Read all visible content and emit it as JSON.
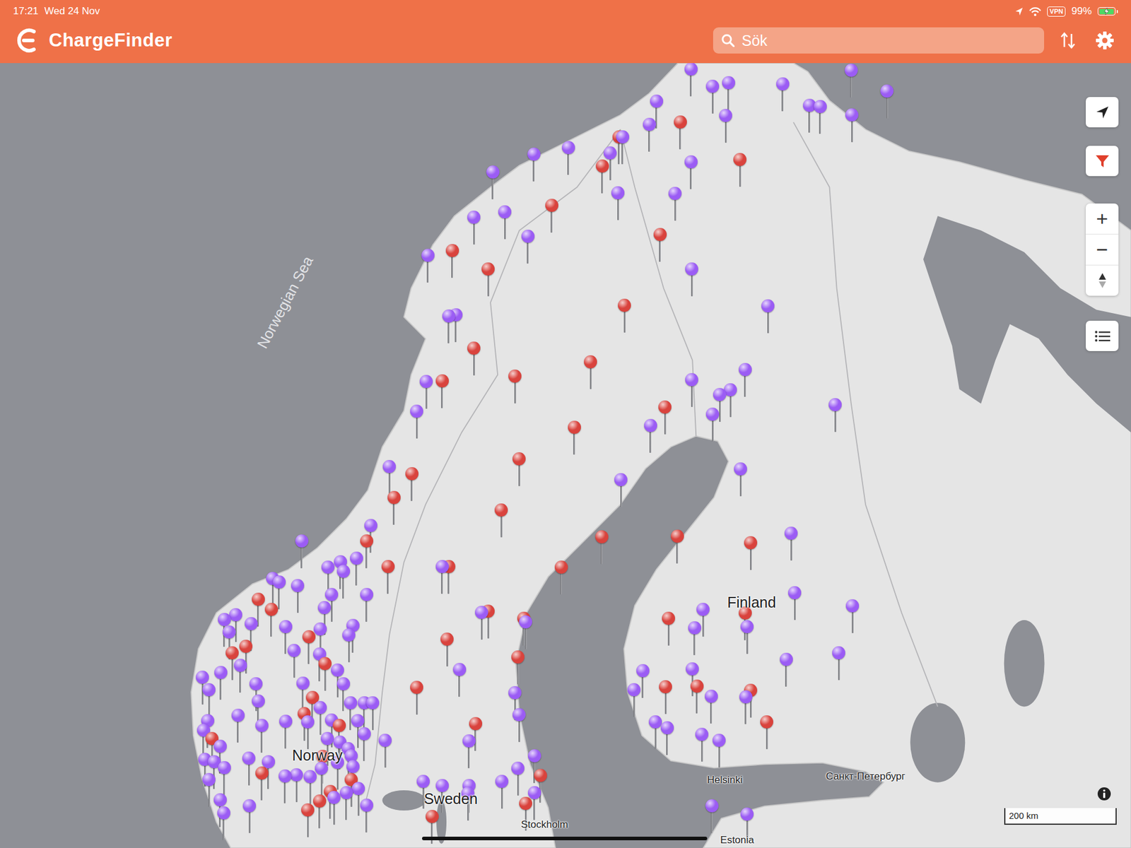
{
  "status_bar": {
    "time": "17:21",
    "date": "Wed 24 Nov",
    "vpn": "VPN",
    "battery": "99%",
    "battery_level": 0.99,
    "charging": true
  },
  "app_bar": {
    "title": "ChargeFinder"
  },
  "search": {
    "placeholder": "Sök"
  },
  "map": {
    "labels": [
      {
        "text": "Norwegian Sea",
        "kind": "sea"
      },
      {
        "text": "Finland",
        "kind": "country"
      },
      {
        "text": "Norway",
        "kind": "country"
      },
      {
        "text": "Sweden",
        "kind": "country"
      },
      {
        "text": "Stockholm",
        "kind": "city"
      },
      {
        "text": "Helsinki",
        "kind": "city"
      },
      {
        "text": "Санкт-Петербург",
        "kind": "city"
      },
      {
        "text": "Estonia",
        "kind": "city"
      }
    ],
    "zoom_in": "+",
    "zoom_out": "−",
    "scale": "200 km"
  },
  "pins": [
    {
      "color": "#9b5cf4"
    },
    {
      "color": "#9b5cf4"
    },
    {
      "color": "#9b5cf4"
    },
    {
      "color": "#9b5cf4"
    },
    {
      "color": "#9b5cf4"
    },
    {
      "color": "#9b5cf4"
    },
    {
      "color": "#9b5cf4"
    },
    {
      "color": "#9b5cf4"
    },
    {
      "color": "#9b5cf4"
    },
    {
      "color": "#9b5cf4"
    },
    {
      "color": "#d9433d"
    },
    {
      "color": "#9b5cf4"
    },
    {
      "color": "#9b5cf4"
    },
    {
      "color": "#d9433d"
    },
    {
      "color": "#9b5cf4"
    },
    {
      "color": "#9b5cf4"
    },
    {
      "color": "#d9433d"
    },
    {
      "color": "#9b5cf4"
    },
    {
      "color": "#9b5cf4"
    },
    {
      "color": "#9b5cf4"
    },
    {
      "color": "#9b5cf4"
    },
    {
      "color": "#d9433d"
    },
    {
      "color": "#9b5cf4"
    },
    {
      "color": "#9b5cf4"
    },
    {
      "color": "#d9433d"
    },
    {
      "color": "#9b5cf4"
    },
    {
      "color": "#9b5cf4"
    },
    {
      "color": "#9b5cf4"
    },
    {
      "color": "#d9433d"
    },
    {
      "color": "#9b5cf4"
    },
    {
      "color": "#d9433d"
    },
    {
      "color": "#d9433d"
    },
    {
      "color": "#9b5cf4"
    },
    {
      "color": "#d9433d"
    },
    {
      "color": "#9b5cf4"
    },
    {
      "color": "#9b5cf4"
    },
    {
      "color": "#9b5cf4"
    },
    {
      "color": "#d9433d"
    },
    {
      "color": "#d9433d"
    },
    {
      "color": "#d9433d"
    },
    {
      "color": "#9b5cf4"
    },
    {
      "color": "#d9433d"
    },
    {
      "color": "#9b5cf4"
    },
    {
      "color": "#9b5cf4"
    },
    {
      "color": "#9b5cf4"
    },
    {
      "color": "#9b5cf4"
    },
    {
      "color": "#9b5cf4"
    },
    {
      "color": "#9b5cf4"
    },
    {
      "color": "#d9433d"
    },
    {
      "color": "#9b5cf4"
    },
    {
      "color": "#d9433d"
    },
    {
      "color": "#9b5cf4"
    },
    {
      "color": "#d9433d"
    },
    {
      "color": "#9b5cf4"
    },
    {
      "color": "#d9433d"
    },
    {
      "color": "#d9433d"
    },
    {
      "color": "#9b5cf4"
    },
    {
      "color": "#9b5cf4"
    },
    {
      "color": "#d9433d"
    },
    {
      "color": "#9b5cf4"
    },
    {
      "color": "#d9433d"
    },
    {
      "color": "#d9433d"
    },
    {
      "color": "#d9433d"
    },
    {
      "color": "#d9433d"
    },
    {
      "color": "#9b5cf4"
    },
    {
      "color": "#9b5cf4"
    },
    {
      "color": "#d9433d"
    },
    {
      "color": "#d9433d"
    },
    {
      "color": "#9b5cf4"
    },
    {
      "color": "#d9433d"
    },
    {
      "color": "#9b5cf4"
    },
    {
      "color": "#9b5cf4"
    },
    {
      "color": "#9b5cf4"
    },
    {
      "color": "#9b5cf4"
    },
    {
      "color": "#9b5cf4"
    },
    {
      "color": "#9b5cf4"
    },
    {
      "color": "#9b5cf4"
    },
    {
      "color": "#9b5cf4"
    },
    {
      "color": "#9b5cf4"
    },
    {
      "color": "#9b5cf4"
    },
    {
      "color": "#9b5cf4"
    },
    {
      "color": "#d9433d"
    },
    {
      "color": "#d9433d"
    },
    {
      "color": "#9b5cf4"
    },
    {
      "color": "#d9433d"
    },
    {
      "color": "#9b5cf4"
    },
    {
      "color": "#d9433d"
    },
    {
      "color": "#9b5cf4"
    },
    {
      "color": "#9b5cf4"
    },
    {
      "color": "#9b5cf4"
    },
    {
      "color": "#9b5cf4"
    },
    {
      "color": "#9b5cf4"
    },
    {
      "color": "#d9433d"
    },
    {
      "color": "#9b5cf4"
    },
    {
      "color": "#9b5cf4"
    },
    {
      "color": "#d9433d"
    },
    {
      "color": "#9b5cf4"
    },
    {
      "color": "#9b5cf4"
    },
    {
      "color": "#9b5cf4"
    },
    {
      "color": "#9b5cf4"
    },
    {
      "color": "#d9433d"
    },
    {
      "color": "#9b5cf4"
    },
    {
      "color": "#d9433d"
    },
    {
      "color": "#d9433d"
    },
    {
      "color": "#d9433d"
    },
    {
      "color": "#9b5cf4"
    },
    {
      "color": "#9b5cf4"
    },
    {
      "color": "#d9433d"
    },
    {
      "color": "#9b5cf4"
    },
    {
      "color": "#9b5cf4"
    },
    {
      "color": "#9b5cf4"
    },
    {
      "color": "#9b5cf4"
    },
    {
      "color": "#d9433d"
    },
    {
      "color": "#9b5cf4"
    },
    {
      "color": "#9b5cf4"
    },
    {
      "color": "#9b5cf4"
    },
    {
      "color": "#9b5cf4"
    },
    {
      "color": "#9b5cf4"
    },
    {
      "color": "#d9433d"
    },
    {
      "color": "#d9433d"
    },
    {
      "color": "#9b5cf4"
    },
    {
      "color": "#9b5cf4"
    },
    {
      "color": "#d9433d"
    },
    {
      "color": "#9b5cf4"
    },
    {
      "color": "#9b5cf4"
    },
    {
      "color": "#d9433d"
    },
    {
      "color": "#9b5cf4"
    },
    {
      "color": "#9b5cf4"
    },
    {
      "color": "#9b5cf4"
    },
    {
      "color": "#9b5cf4"
    },
    {
      "color": "#9b5cf4"
    },
    {
      "color": "#9b5cf4"
    },
    {
      "color": "#9b5cf4"
    },
    {
      "color": "#9b5cf4"
    },
    {
      "color": "#d9433d"
    },
    {
      "color": "#9b5cf4"
    },
    {
      "color": "#d9433d"
    },
    {
      "color": "#9b5cf4"
    },
    {
      "color": "#9b5cf4"
    },
    {
      "color": "#9b5cf4"
    },
    {
      "color": "#9b5cf4"
    },
    {
      "color": "#9b5cf4"
    },
    {
      "color": "#9b5cf4"
    },
    {
      "color": "#9b5cf4"
    },
    {
      "color": "#9b5cf4"
    },
    {
      "color": "#d9433d"
    },
    {
      "color": "#9b5cf4"
    },
    {
      "color": "#9b5cf4"
    },
    {
      "color": "#9b5cf4"
    },
    {
      "color": "#9b5cf4"
    },
    {
      "color": "#9b5cf4"
    },
    {
      "color": "#9b5cf4"
    },
    {
      "color": "#9b5cf4"
    },
    {
      "color": "#d9433d"
    },
    {
      "color": "#9b5cf4"
    },
    {
      "color": "#9b5cf4"
    },
    {
      "color": "#9b5cf4"
    },
    {
      "color": "#d9433d"
    },
    {
      "color": "#9b5cf4"
    },
    {
      "color": "#9b5cf4"
    },
    {
      "color": "#9b5cf4"
    },
    {
      "color": "#9b5cf4"
    },
    {
      "color": "#9b5cf4"
    },
    {
      "color": "#9b5cf4"
    },
    {
      "color": "#9b5cf4"
    },
    {
      "color": "#9b5cf4"
    },
    {
      "color": "#d9433d"
    },
    {
      "color": "#9b5cf4"
    },
    {
      "color": "#9b5cf4"
    },
    {
      "color": "#9b5cf4"
    },
    {
      "color": "#9b5cf4"
    },
    {
      "color": "#d9433d"
    },
    {
      "color": "#d9433d"
    },
    {
      "color": "#9b5cf4"
    },
    {
      "color": "#d9433d"
    },
    {
      "color": "#d9433d"
    },
    {
      "color": "#9b5cf4"
    },
    {
      "color": "#9b5cf4"
    },
    {
      "color": "#9b5cf4"
    },
    {
      "color": "#9b5cf4"
    },
    {
      "color": "#d9433d"
    },
    {
      "color": "#9b5cf4"
    },
    {
      "color": "#9b5cf4"
    },
    {
      "color": "#9b5cf4"
    },
    {
      "color": "#9b5cf4"
    },
    {
      "color": "#9b5cf4"
    },
    {
      "color": "#d9433d"
    },
    {
      "color": "#9b5cf4"
    },
    {
      "color": "#9b5cf4"
    },
    {
      "color": "#d9433d"
    },
    {
      "color": "#9b5cf4"
    },
    {
      "color": "#9b5cf4"
    },
    {
      "color": "#d9433d"
    },
    {
      "color": "#9b5cf4"
    },
    {
      "color": "#9b5cf4"
    },
    {
      "color": "#9b5cf4"
    },
    {
      "color": "#9b5cf4"
    },
    {
      "color": "#d9433d"
    },
    {
      "color": "#9b5cf4"
    },
    {
      "color": "#9b5cf4"
    }
  ]
}
